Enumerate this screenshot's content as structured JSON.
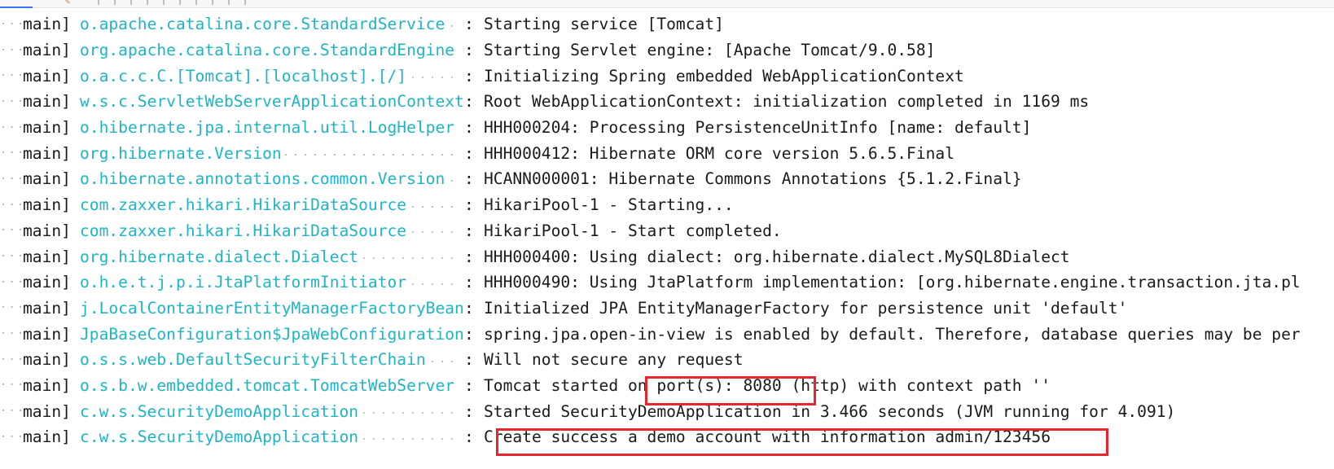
{
  "log": {
    "rows": [
      {
        "thread": "main]",
        "logger": "o.apache.catalina.core.StandardService",
        "sep": ":",
        "message": "Starting service [Tomcat]"
      },
      {
        "thread": "main]",
        "logger": "org.apache.catalina.core.StandardEngine",
        "sep": ":",
        "message": "Starting Servlet engine: [Apache Tomcat/9.0.58]"
      },
      {
        "thread": "main]",
        "logger": "o.a.c.c.C.[Tomcat].[localhost].[/]",
        "sep": ":",
        "message": "Initializing Spring embedded WebApplicationContext"
      },
      {
        "thread": "main]",
        "logger": "w.s.c.ServletWebServerApplicationContext",
        "sep": ":",
        "message": "Root WebApplicationContext: initialization completed in 1169 ms"
      },
      {
        "thread": "main]",
        "logger": "o.hibernate.jpa.internal.util.LogHelper",
        "sep": ":",
        "message": "HHH000204: Processing PersistenceUnitInfo [name: default]"
      },
      {
        "thread": "main]",
        "logger": "org.hibernate.Version",
        "sep": ":",
        "message": "HHH000412: Hibernate ORM core version 5.6.5.Final"
      },
      {
        "thread": "main]",
        "logger": "o.hibernate.annotations.common.Version",
        "sep": ":",
        "message": "HCANN000001: Hibernate Commons Annotations {5.1.2.Final}"
      },
      {
        "thread": "main]",
        "logger": "com.zaxxer.hikari.HikariDataSource",
        "sep": ":",
        "message": "HikariPool-1 - Starting..."
      },
      {
        "thread": "main]",
        "logger": "com.zaxxer.hikari.HikariDataSource",
        "sep": ":",
        "message": "HikariPool-1 - Start completed."
      },
      {
        "thread": "main]",
        "logger": "org.hibernate.dialect.Dialect",
        "sep": ":",
        "message": "HHH000400: Using dialect: org.hibernate.dialect.MySQL8Dialect"
      },
      {
        "thread": "main]",
        "logger": "o.h.e.t.j.p.i.JtaPlatformInitiator",
        "sep": ":",
        "message": "HHH000490: Using JtaPlatform implementation: [org.hibernate.engine.transaction.jta.pl"
      },
      {
        "thread": "main]",
        "logger": "j.LocalContainerEntityManagerFactoryBean",
        "sep": ":",
        "message": "Initialized JPA EntityManagerFactory for persistence unit 'default'"
      },
      {
        "thread": "main]",
        "logger": "JpaBaseConfiguration$JpaWebConfiguration",
        "sep": ":",
        "message": "spring.jpa.open-in-view is enabled by default. Therefore, database queries may be per"
      },
      {
        "thread": "main]",
        "logger": "o.s.s.web.DefaultSecurityFilterChain",
        "sep": ":",
        "message": "Will not secure any request"
      },
      {
        "thread": "main]",
        "logger": "o.s.b.w.embedded.tomcat.TomcatWebServer",
        "sep": ":",
        "message": "Tomcat started on port(s): 8080 (http) with context path ''"
      },
      {
        "thread": "main]",
        "logger": "c.w.s.SecurityDemoApplication",
        "sep": ":",
        "message": "Started SecurityDemoApplication in 3.466 seconds (JVM running for 4.091)"
      },
      {
        "thread": "main]",
        "logger": "c.w.s.SecurityDemoApplication",
        "sep": ":",
        "message": "Create success a demo account with information admin/123456"
      }
    ]
  },
  "colors": {
    "logger": "#1fb5c4",
    "text": "#1a1a1a",
    "highlight_border": "#e8262b"
  }
}
